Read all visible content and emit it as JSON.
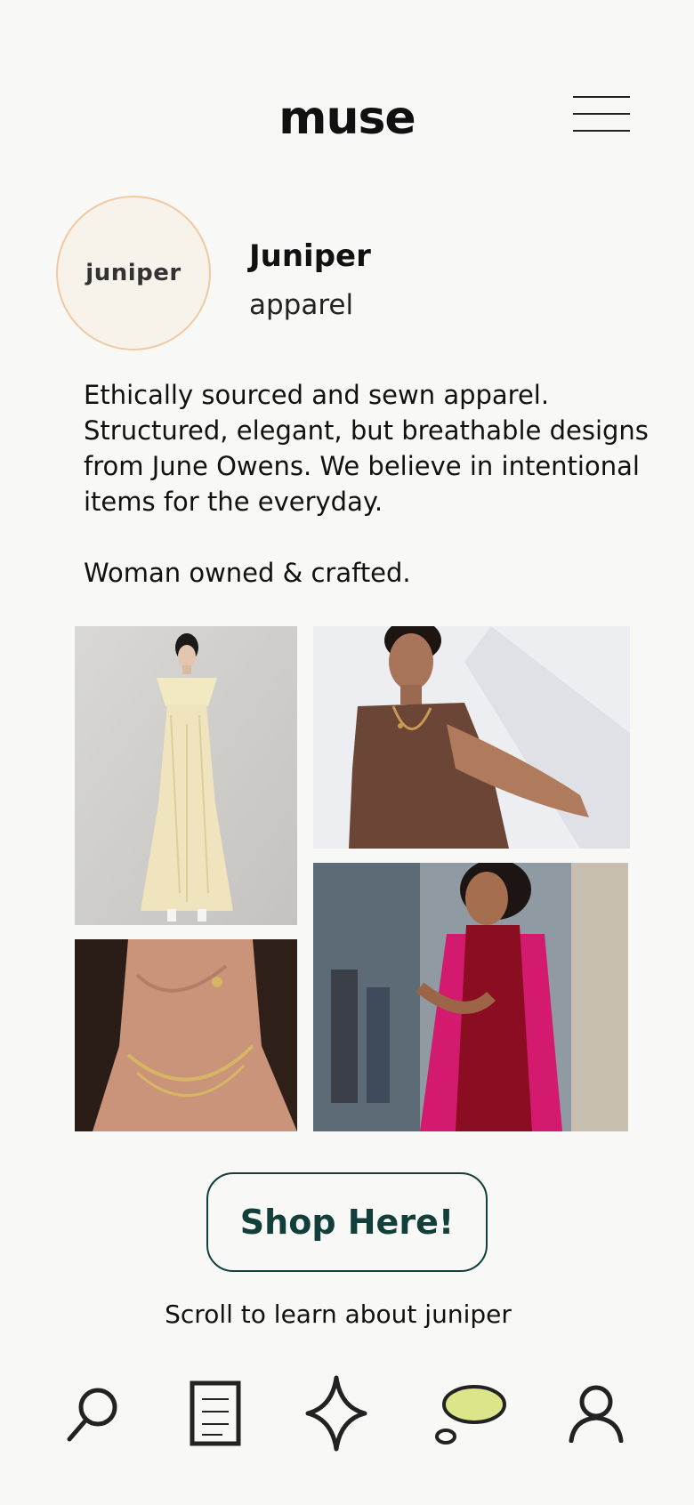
{
  "header": {
    "app_title": "muse",
    "menu_icon": "hamburger-menu-icon"
  },
  "brand": {
    "logo_text": "juniper",
    "name": "Juniper",
    "category": "apparel",
    "description": "Ethically sourced and sewn apparel. Structured, elegant, but breathable designs from June Owens. We believe in intentional items for the everyday.",
    "tagline": "Woman owned & crafted."
  },
  "gallery": [
    {
      "id": "dress",
      "subject": "model in cream pleated dress"
    },
    {
      "id": "brown",
      "subject": "model in brown dress seated"
    },
    {
      "id": "necklace",
      "subject": "gold layered necklaces close-up"
    },
    {
      "id": "pink",
      "subject": "model in magenta coat and red knit"
    }
  ],
  "cta": {
    "shop_label": "Shop Here!",
    "scroll_hint": "Scroll to learn about juniper"
  },
  "nav": [
    {
      "id": "search",
      "icon": "search-icon"
    },
    {
      "id": "doc",
      "icon": "document-icon"
    },
    {
      "id": "sparkle",
      "icon": "sparkle-icon"
    },
    {
      "id": "chat",
      "icon": "chat-bubble-icon",
      "active": true
    },
    {
      "id": "profile",
      "icon": "profile-icon"
    }
  ],
  "colors": {
    "accent": "#123f3a",
    "background": "#f8f8f6",
    "logo_ring": "#f0c9a3",
    "chat_active": "#dde58a"
  }
}
